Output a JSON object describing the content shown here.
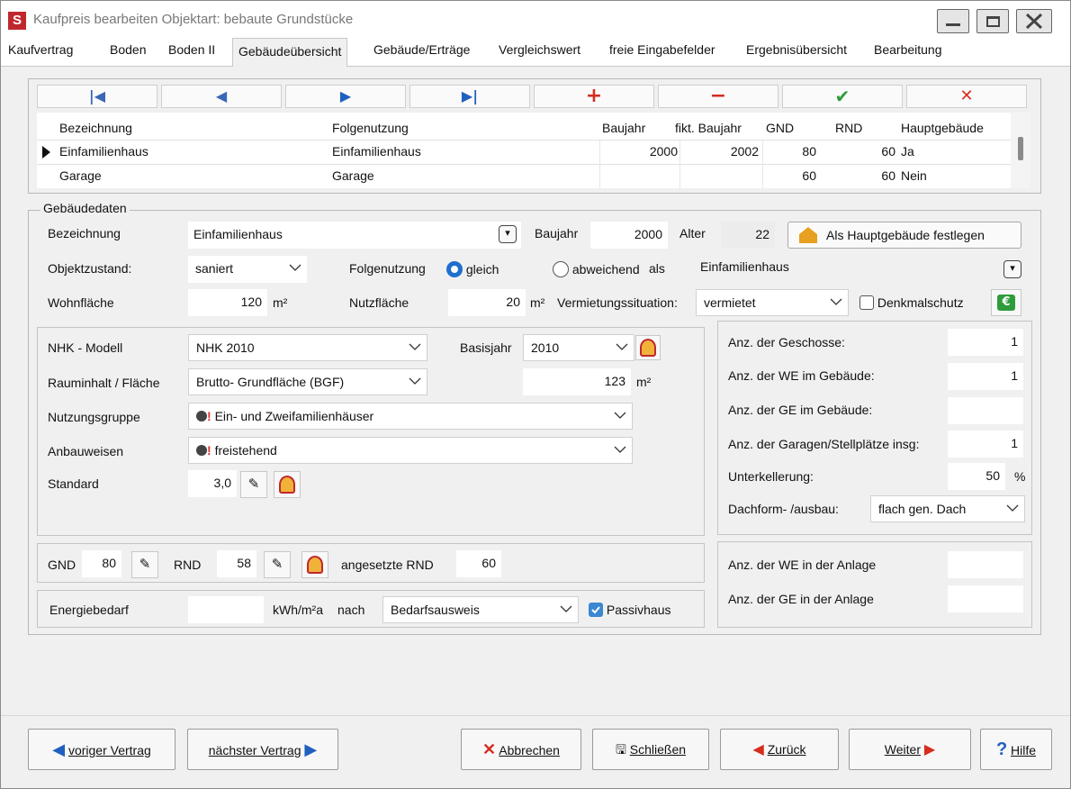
{
  "window": {
    "title": "Kaufpreis bearbeiten  Objektart: bebaute Grundstücke",
    "logo_letter": "S"
  },
  "tabs": [
    {
      "label": "Kaufvertrag"
    },
    {
      "label": "Boden"
    },
    {
      "label": "Boden II"
    },
    {
      "label": "Gebäudeübersicht"
    },
    {
      "label": "Gebäude/Erträge"
    },
    {
      "label": "Vergleichswert"
    },
    {
      "label": "freie Eingabefelder"
    },
    {
      "label": "Ergebnisübersicht"
    },
    {
      "label": "Bearbeitung"
    }
  ],
  "navigator": {
    "first": "|◀",
    "prev": "◀",
    "next": "▶",
    "last": "▶|",
    "add": "+",
    "delete": "−",
    "confirm": "✔",
    "cancel": "✕"
  },
  "grid": {
    "headers": {
      "bez": "Bezeichnung",
      "folge": "Folgenutzung",
      "baujahr": "Baujahr",
      "fikt": "fikt. Baujahr",
      "gnd": "GND",
      "rnd": "RND",
      "haupt": "Hauptgebäude"
    },
    "rows": [
      {
        "bez": "Einfamilienhaus",
        "folge": "Einfamilienhaus",
        "baujahr": "2000",
        "fikt": "2002",
        "gnd": "80",
        "rnd": "60",
        "haupt": "Ja"
      },
      {
        "bez": "Garage",
        "folge": "Garage",
        "baujahr": "",
        "fikt": "",
        "gnd": "60",
        "rnd": "60",
        "haupt": "Nein"
      }
    ]
  },
  "gebaeudedaten": {
    "group_label": "Gebäudedaten",
    "bezeichnung_label": "Bezeichnung",
    "bezeichnung_value": "Einfamilienhaus",
    "baujahr_label": "Baujahr",
    "baujahr_value": "2000",
    "alter_label": "Alter",
    "alter_value": "22",
    "haupt_button": "Als Hauptgebäude festlegen",
    "objektzustand_label": "Objektzustand:",
    "objektzustand_value": "saniert",
    "folgenutzung_label": "Folgenutzung",
    "radio_gleich": "gleich",
    "radio_abweichend": "abweichend",
    "als_label": "als",
    "folgenutzung_value": "Einfamilienhaus",
    "wohnflaeche_label": "Wohnfläche",
    "wohnflaeche_value": "120",
    "unit_m2": "m²",
    "nutzflaeche_label": "Nutzfläche",
    "nutzflaeche_value": "20",
    "vermietung_label": "Vermietungssituation:",
    "vermietung_value": "vermietet",
    "denkmal_label": "Denkmalschutz",
    "euro_icon": "€"
  },
  "nhk": {
    "modell_label": "NHK - Modell",
    "modell_value": "NHK 2010",
    "basisjahr_label": "Basisjahr",
    "basisjahr_value": "2010",
    "rauminhalt_label": "Rauminhalt / Fläche",
    "rauminhalt_value": "Brutto- Grundfläche (BGF)",
    "flaeche_value": "123",
    "unit_m2": "m²",
    "nutzungsgruppe_label": "Nutzungsgruppe",
    "nutzungsgruppe_value": "Ein- und Zweifamilienhäuser",
    "anbauweisen_label": "Anbauweisen",
    "anbauweisen_value": "freistehend",
    "standard_label": "Standard",
    "standard_value": "3,0"
  },
  "rights": {
    "geschosse_label": "Anz. der Geschosse:",
    "geschosse_value": "1",
    "we_label": "Anz. der WE im Gebäude:",
    "we_value": "1",
    "ge_label": "Anz. der GE im Gebäude:",
    "ge_value": "",
    "garagen_label": "Anz. der Garagen/Stellplätze insg:",
    "garagen_value": "1",
    "unterkellerung_label": "Unterkellerung:",
    "unterkellerung_value": "50",
    "percent": "%",
    "dach_label": "Dachform- /ausbau:",
    "dach_value": "flach gen. Dach",
    "we_anlage_label": "Anz. der WE in der Anlage",
    "we_anlage_value": "",
    "ge_anlage_label": "Anz. der GE in der Anlage",
    "ge_anlage_value": ""
  },
  "nd": {
    "gnd_label": "GND",
    "gnd_value": "80",
    "rnd_label": "RND",
    "rnd_value": "58",
    "angesetzt_label": "angesetzte RND",
    "angesetzt_value": "60"
  },
  "energie": {
    "label": "Energiebedarf",
    "value": "",
    "unit": "kWh/m²a",
    "nach_label": "nach",
    "ausweis_value": "Bedarfsausweis",
    "passiv_label": "Passivhaus"
  },
  "buttons": {
    "prev_contract": "voriger Vertrag",
    "next_contract": "nächster Vertrag",
    "abbrechen": "Abbrechen",
    "schliessen": "Schließen",
    "zurueck": "Zurück",
    "weiter": "Weiter",
    "hilfe": "Hilfe"
  },
  "colors": {
    "accent_red": "#d62d20",
    "accent_blue": "#1f5fbf",
    "confirm_green": "#2e9c3a"
  }
}
